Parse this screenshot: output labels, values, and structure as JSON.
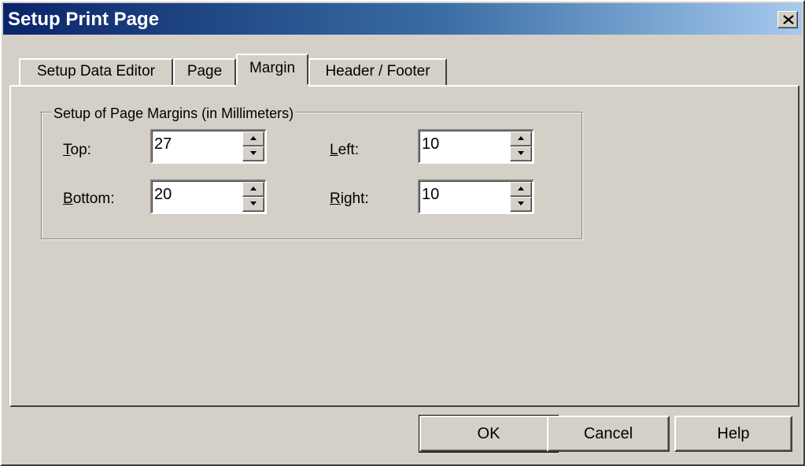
{
  "window": {
    "title": "Setup Print Page",
    "close_icon": "close-icon"
  },
  "tabs": [
    {
      "label": "Setup Data Editor",
      "active": false
    },
    {
      "label": "Page",
      "active": false
    },
    {
      "label": "Margin",
      "active": true
    },
    {
      "label": "Header / Footer",
      "active": false
    }
  ],
  "margins": {
    "group_caption": "Setup of  Page Margins (in Millimeters)",
    "top": {
      "mnemonic": "T",
      "label_rest": "op:",
      "value": "27"
    },
    "bottom": {
      "mnemonic": "B",
      "label_rest": "ottom:",
      "value": "20"
    },
    "left": {
      "mnemonic": "L",
      "label_rest": "eft:",
      "value": "10"
    },
    "right": {
      "mnemonic": "R",
      "label_rest": "ight:",
      "value": "10"
    }
  },
  "buttons": {
    "ok": "OK",
    "cancel": "Cancel",
    "help": "Help"
  }
}
